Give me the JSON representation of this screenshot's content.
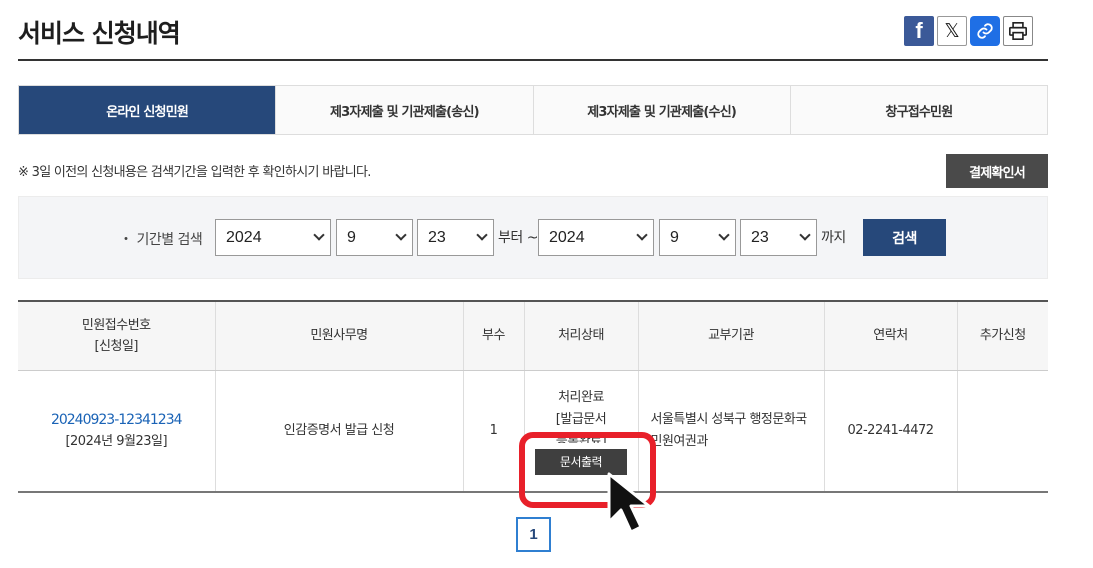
{
  "page": {
    "title": "서비스 신청내역"
  },
  "share": {
    "facebook_icon": "f",
    "x_icon": "𝕏",
    "link_icon": "🔗",
    "print_icon": "printer"
  },
  "tabs": [
    {
      "label": "온라인 신청민원",
      "active": true
    },
    {
      "label": "제3자제출 및 기관제출(송신)",
      "active": false
    },
    {
      "label": "제3자제출 및 기관제출(수신)",
      "active": false
    },
    {
      "label": "창구접수민원",
      "active": false
    }
  ],
  "notice": "※ 3일 이전의 신청내용은 검색기간을 입력한 후 확인하시기 바랍니다.",
  "receipt_button": "결제확인서",
  "search": {
    "label": "・ 기간별 검색",
    "from_year": "2024",
    "from_month": "9",
    "from_day": "23",
    "from_suffix": "부터 ~",
    "to_year": "2024",
    "to_month": "9",
    "to_day": "23",
    "to_suffix": "까지",
    "button": "검색"
  },
  "table": {
    "headers": {
      "receipt_no_line1": "민원접수번호",
      "receipt_no_line2": "[신청일]",
      "service": "민원사무명",
      "copies": "부수",
      "status": "처리상태",
      "agency": "교부기관",
      "contact": "연락처",
      "extra": "추가신청"
    },
    "rows": [
      {
        "receipt_no": "20240923-12341234",
        "date": "[2024년 9월23일]",
        "service": "인감증명서 발급 신청",
        "copies": "1",
        "status_line1": "처리완료",
        "status_line2": "[발급문서",
        "status_line3": "등록완료]",
        "print_button": "문서출력",
        "agency_line1": "서울특별시 성북구 행정문화국",
        "agency_line2": "민원여권과",
        "contact": "02-2241-4472",
        "extra": ""
      }
    ]
  },
  "pagination": {
    "current": "1"
  },
  "colors": {
    "primary": "#26487a",
    "highlight": "#e8202a",
    "link": "#1a63b6"
  }
}
